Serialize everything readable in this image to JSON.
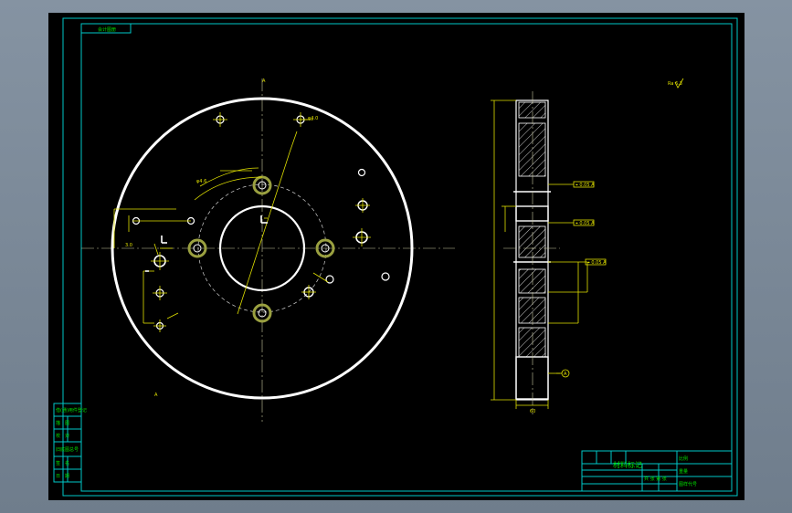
{
  "drawing": {
    "corner_label": "会计图册",
    "roughness": "Ra 6.3",
    "section_marker": "A",
    "dim_thickness": "60",
    "dim_height": "3.0",
    "dim_bore": "φ4.0",
    "dim_pitch": "φ4.6",
    "tol_frame_1": "⌖ 0.05 A",
    "tol_frame_2": "⌖ 0.05 A",
    "tol_frame_3": "⌖ 0.05 A",
    "left_panel_rows": [
      "借(通)用件登记",
      "描　图",
      "校　对",
      "旧底图总号",
      "签　名",
      "日　期"
    ],
    "title_block": {
      "material_mark": "材料标记",
      "scale_label": "比例",
      "weight_label": "重量",
      "drawing_no_label": "图样代号",
      "sheet_label": "共 张 第 张"
    }
  }
}
